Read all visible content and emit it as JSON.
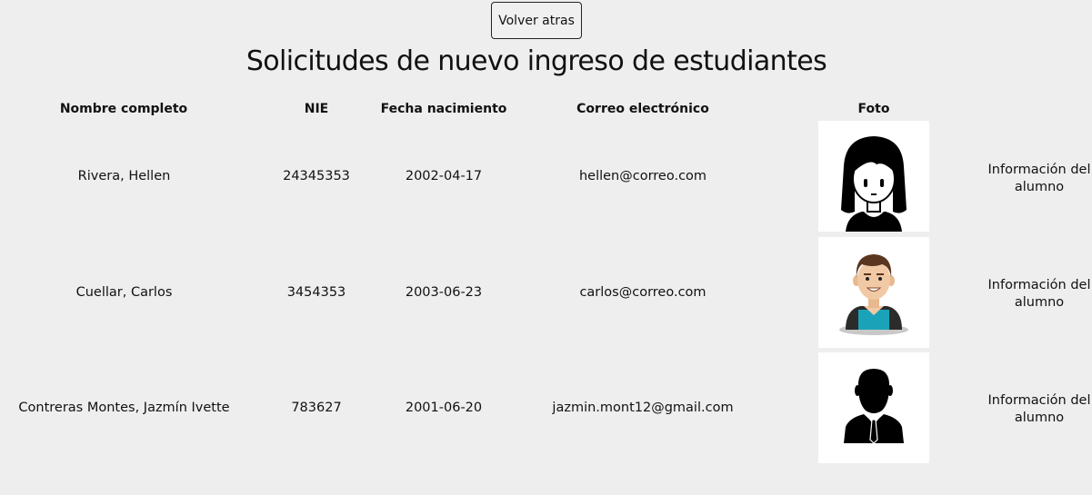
{
  "header": {
    "back_button": "Volver atras",
    "title": "Solicitudes de nuevo ingreso de estudiantes"
  },
  "table": {
    "columns": [
      "Nombre completo",
      "NIE",
      "Fecha nacimiento",
      "Correo electrónico",
      "Foto"
    ],
    "rows": [
      {
        "name": "Rivera, Hellen",
        "nie": "24345353",
        "birth_date": "2002-04-17",
        "email": "hellen@correo.com",
        "photo_icon": "female-avatar-icon",
        "info_link": "Información del alumno"
      },
      {
        "name": "Cuellar, Carlos",
        "nie": "3454353",
        "birth_date": "2003-06-23",
        "email": "carlos@correo.com",
        "photo_icon": "male-avatar-icon",
        "info_link": "Información del alumno"
      },
      {
        "name": "Contreras Montes, Jazmín Ivette",
        "nie": "783627",
        "birth_date": "2001-06-20",
        "email": "jazmin.mont12@gmail.com",
        "photo_icon": "businessman-silhouette-icon",
        "info_link": "Información del alumno"
      }
    ]
  },
  "colors": {
    "background": "#eeeeee",
    "text": "#111111",
    "shirt_teal": "#1aa3b8"
  }
}
